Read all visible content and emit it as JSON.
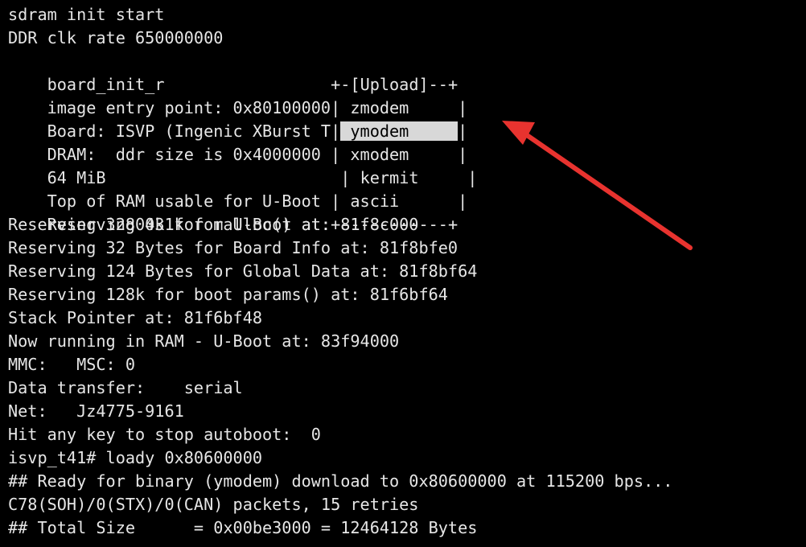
{
  "colors": {
    "background": "#000000",
    "text": "#e6e6e6",
    "highlight_bg": "#d8d8d8",
    "highlight_text": "#000000",
    "arrow": "#e8332f"
  },
  "terminal": {
    "top_partial": "                      ",
    "lines": [
      "sdram init start",
      "DDR clk rate 650000000",
      "board_init_r",
      "image entry point: 0x80100000",
      "Board: ISVP (Ingenic XBurst T",
      "DRAM:  ddr size is 0x4000000",
      "64 MiB",
      "Top of RAM usable for U-Boot",
      "Reserving 431k for U-Boot at:",
      "Reserving 32800k for malloc() at: 81f8c000",
      "Reserving 32 Bytes for Board Info at: 81f8bfe0",
      "Reserving 124 Bytes for Global Data at: 81f8bf64",
      "Reserving 128k for boot params() at: 81f6bf64",
      "Stack Pointer at: 81f6bf48",
      "Now running in RAM - U-Boot at: 83f94000",
      "MMC:   MSC: 0",
      "Data transfer:    serial",
      "Net:   Jz4775-9161",
      "Hit any key to stop autoboot:  0",
      "isvp_t41# loady 0x80600000",
      "## Ready for binary (ymodem) download to 0x80600000 at 115200 bps...",
      "C78(SOH)/0(STX)/0(CAN) packets, 15 retries",
      "## Total Size      = 0x00be3000 = 12464128 Bytes"
    ],
    "upload_menu": {
      "top_border": "+-[Upload]--+",
      "bottom_border": "+-----------+",
      "left_border_char": "|",
      "right_border_char": "|",
      "options": [
        "zmodem",
        "ymodem",
        "xmodem",
        "kermit",
        "ascii"
      ],
      "selected_index": 1
    }
  }
}
